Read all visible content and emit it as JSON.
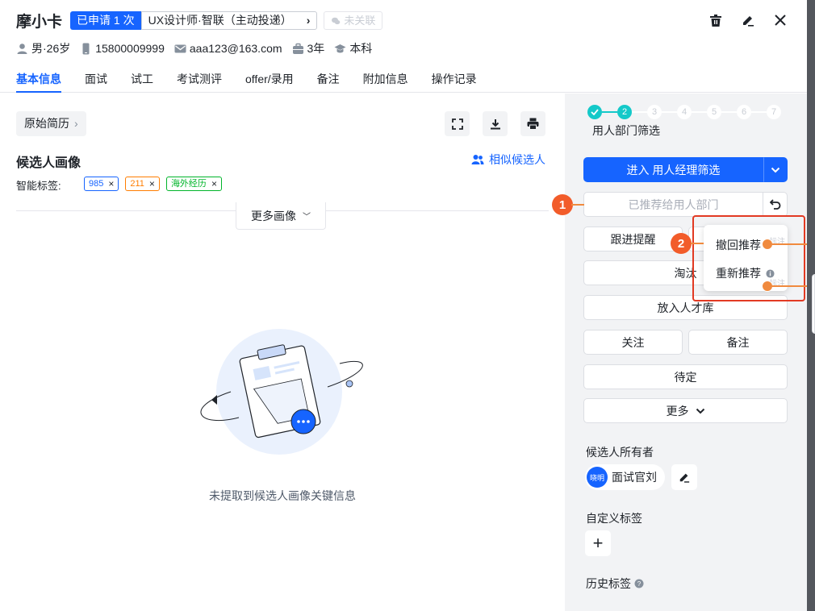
{
  "header": {
    "name": "摩小卡",
    "apply_tag": "已申请 1 次",
    "job": "UX设计师·智联（主动投递）",
    "link_status": "未关联"
  },
  "info": {
    "gender_age": "男·26岁",
    "phone": "15800009999",
    "email": "aaa123@163.com",
    "experience": "3年",
    "education": "本科"
  },
  "tabs": [
    "基本信息",
    "面试",
    "试工",
    "考试测评",
    "offer/录用",
    "备注",
    "附加信息",
    "操作记录"
  ],
  "left": {
    "resume_btn": "原始简历",
    "portrait_title": "候选人画像",
    "similar_link": "相似候选人",
    "smart_label": "智能标签:",
    "tags": [
      {
        "text": "985",
        "color": "#1664ff"
      },
      {
        "text": "211",
        "color": "#ff7d00"
      },
      {
        "text": "海外经历",
        "color": "#00b42a"
      }
    ],
    "more_portrait": "更多画像",
    "empty_text": "未提取到候选人画像关键信息"
  },
  "right": {
    "steps": [
      "2",
      "3",
      "4",
      "5",
      "6",
      "7"
    ],
    "step_label": "用人部门筛选",
    "enter_btn": "进入 用人经理筛选",
    "recommended": "已推荐给用人部门",
    "follow_up": "跟进提醒",
    "eliminate": "淘汰",
    "talent_pool": "放入人才库",
    "attention": "关注",
    "remark": "备注",
    "pending": "待定",
    "more": "更多",
    "owner_label": "候选人所有者",
    "owner_avatar": "晓明",
    "owner_name": "面试官刘",
    "custom_tags_label": "自定义标签",
    "history_tags_label": "历史标签"
  },
  "popover": {
    "withdraw": "撤回推荐",
    "re_recommend": "重新推荐"
  },
  "annotations": {
    "num1": "1",
    "num2": "2",
    "note1": "标注",
    "note2": "标注"
  },
  "colors": {
    "primary": "#1664ff",
    "step": "#14c9c9",
    "annotation": "#f25c2a",
    "highlight": "#e23a23"
  }
}
